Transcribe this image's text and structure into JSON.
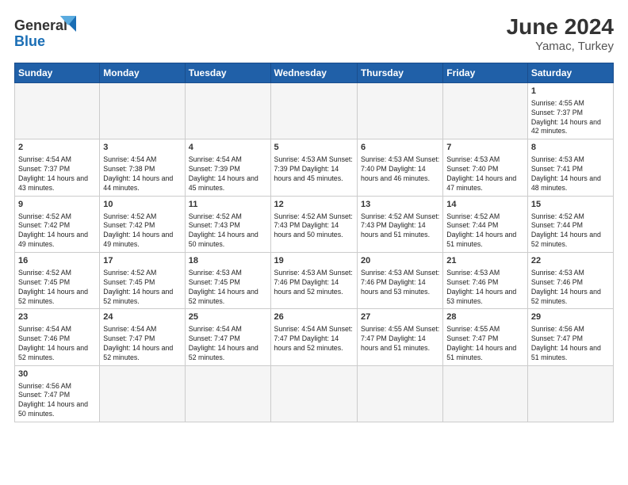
{
  "header": {
    "logo_general": "General",
    "logo_blue": "Blue",
    "month_year": "June 2024",
    "location": "Yamac, Turkey"
  },
  "weekdays": [
    "Sunday",
    "Monday",
    "Tuesday",
    "Wednesday",
    "Thursday",
    "Friday",
    "Saturday"
  ],
  "weeks": [
    [
      {
        "day": "",
        "info": ""
      },
      {
        "day": "",
        "info": ""
      },
      {
        "day": "",
        "info": ""
      },
      {
        "day": "",
        "info": ""
      },
      {
        "day": "",
        "info": ""
      },
      {
        "day": "",
        "info": ""
      },
      {
        "day": "1",
        "info": "Sunrise: 4:55 AM\nSunset: 7:37 PM\nDaylight: 14 hours and 42 minutes."
      }
    ],
    [
      {
        "day": "2",
        "info": "Sunrise: 4:54 AM\nSunset: 7:37 PM\nDaylight: 14 hours and 43 minutes."
      },
      {
        "day": "3",
        "info": "Sunrise: 4:54 AM\nSunset: 7:38 PM\nDaylight: 14 hours and 44 minutes."
      },
      {
        "day": "4",
        "info": "Sunrise: 4:54 AM\nSunset: 7:39 PM\nDaylight: 14 hours and 45 minutes."
      },
      {
        "day": "5",
        "info": "Sunrise: 4:53 AM\nSunset: 7:39 PM\nDaylight: 14 hours and 45 minutes."
      },
      {
        "day": "6",
        "info": "Sunrise: 4:53 AM\nSunset: 7:40 PM\nDaylight: 14 hours and 46 minutes."
      },
      {
        "day": "7",
        "info": "Sunrise: 4:53 AM\nSunset: 7:40 PM\nDaylight: 14 hours and 47 minutes."
      },
      {
        "day": "8",
        "info": "Sunrise: 4:53 AM\nSunset: 7:41 PM\nDaylight: 14 hours and 48 minutes."
      }
    ],
    [
      {
        "day": "9",
        "info": "Sunrise: 4:52 AM\nSunset: 7:42 PM\nDaylight: 14 hours and 49 minutes."
      },
      {
        "day": "10",
        "info": "Sunrise: 4:52 AM\nSunset: 7:42 PM\nDaylight: 14 hours and 49 minutes."
      },
      {
        "day": "11",
        "info": "Sunrise: 4:52 AM\nSunset: 7:43 PM\nDaylight: 14 hours and 50 minutes."
      },
      {
        "day": "12",
        "info": "Sunrise: 4:52 AM\nSunset: 7:43 PM\nDaylight: 14 hours and 50 minutes."
      },
      {
        "day": "13",
        "info": "Sunrise: 4:52 AM\nSunset: 7:43 PM\nDaylight: 14 hours and 51 minutes."
      },
      {
        "day": "14",
        "info": "Sunrise: 4:52 AM\nSunset: 7:44 PM\nDaylight: 14 hours and 51 minutes."
      },
      {
        "day": "15",
        "info": "Sunrise: 4:52 AM\nSunset: 7:44 PM\nDaylight: 14 hours and 52 minutes."
      }
    ],
    [
      {
        "day": "16",
        "info": "Sunrise: 4:52 AM\nSunset: 7:45 PM\nDaylight: 14 hours and 52 minutes."
      },
      {
        "day": "17",
        "info": "Sunrise: 4:52 AM\nSunset: 7:45 PM\nDaylight: 14 hours and 52 minutes."
      },
      {
        "day": "18",
        "info": "Sunrise: 4:53 AM\nSunset: 7:45 PM\nDaylight: 14 hours and 52 minutes."
      },
      {
        "day": "19",
        "info": "Sunrise: 4:53 AM\nSunset: 7:46 PM\nDaylight: 14 hours and 52 minutes."
      },
      {
        "day": "20",
        "info": "Sunrise: 4:53 AM\nSunset: 7:46 PM\nDaylight: 14 hours and 53 minutes."
      },
      {
        "day": "21",
        "info": "Sunrise: 4:53 AM\nSunset: 7:46 PM\nDaylight: 14 hours and 53 minutes."
      },
      {
        "day": "22",
        "info": "Sunrise: 4:53 AM\nSunset: 7:46 PM\nDaylight: 14 hours and 52 minutes."
      }
    ],
    [
      {
        "day": "23",
        "info": "Sunrise: 4:54 AM\nSunset: 7:46 PM\nDaylight: 14 hours and 52 minutes."
      },
      {
        "day": "24",
        "info": "Sunrise: 4:54 AM\nSunset: 7:47 PM\nDaylight: 14 hours and 52 minutes."
      },
      {
        "day": "25",
        "info": "Sunrise: 4:54 AM\nSunset: 7:47 PM\nDaylight: 14 hours and 52 minutes."
      },
      {
        "day": "26",
        "info": "Sunrise: 4:54 AM\nSunset: 7:47 PM\nDaylight: 14 hours and 52 minutes."
      },
      {
        "day": "27",
        "info": "Sunrise: 4:55 AM\nSunset: 7:47 PM\nDaylight: 14 hours and 51 minutes."
      },
      {
        "day": "28",
        "info": "Sunrise: 4:55 AM\nSunset: 7:47 PM\nDaylight: 14 hours and 51 minutes."
      },
      {
        "day": "29",
        "info": "Sunrise: 4:56 AM\nSunset: 7:47 PM\nDaylight: 14 hours and 51 minutes."
      }
    ],
    [
      {
        "day": "30",
        "info": "Sunrise: 4:56 AM\nSunset: 7:47 PM\nDaylight: 14 hours and 50 minutes."
      },
      {
        "day": "",
        "info": ""
      },
      {
        "day": "",
        "info": ""
      },
      {
        "day": "",
        "info": ""
      },
      {
        "day": "",
        "info": ""
      },
      {
        "day": "",
        "info": ""
      },
      {
        "day": "",
        "info": ""
      }
    ]
  ]
}
